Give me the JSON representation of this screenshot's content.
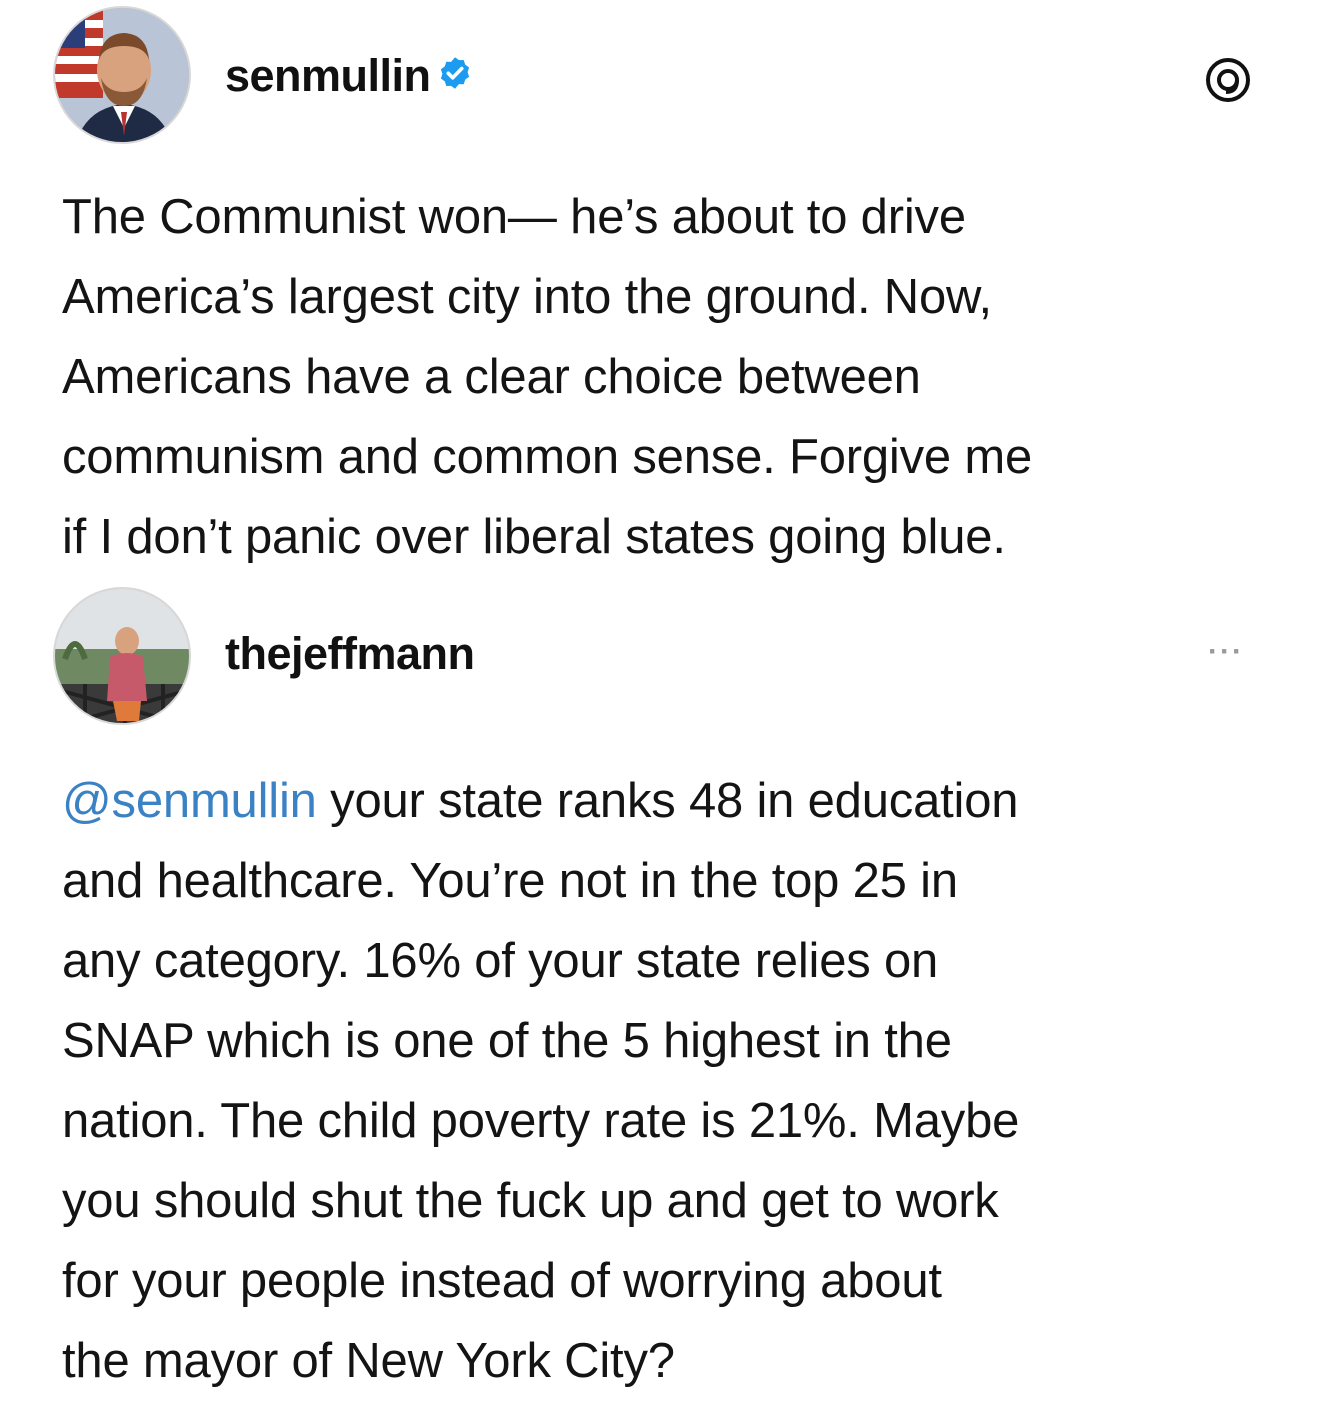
{
  "post1": {
    "username": "senmullin",
    "verified_icon": "verified-badge-icon",
    "app_icon": "threads-icon",
    "lines": [
      "The Communist won— he’s about to drive",
      "America’s largest city into the ground. Now,",
      "Americans have a clear choice between",
      "communism and common sense. Forgive me",
      "if I don’t panic over liberal states going blue."
    ]
  },
  "post2": {
    "username": "thejeffmann",
    "more_label": "···",
    "mention": "@senmullin",
    "first_line_rest": " your state ranks 48 in education",
    "lines": [
      "and healthcare. You’re not in the top 25 in",
      "any category. 16% of your state relies on",
      "SNAP which is one of the 5 highest in the",
      "nation. The child poverty rate is 21%. Maybe",
      "you should shut the fuck up and get to work",
      "for your people instead of worrying about",
      "the mayor of New York City?"
    ]
  },
  "colors": {
    "mention": "#3b82c4",
    "verified": "#1d9bf0",
    "text": "#141414"
  }
}
